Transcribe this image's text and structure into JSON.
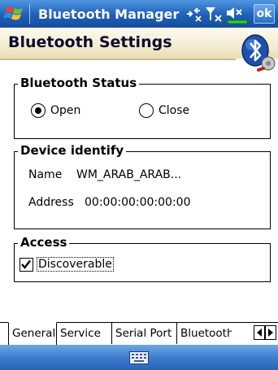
{
  "titlebar": {
    "app_title": "Bluetooth Manager",
    "ok_label": "ok"
  },
  "header": {
    "title": "Bluetooth Settings"
  },
  "status_group": {
    "title": "Bluetooth Status",
    "options": [
      {
        "label": "Open",
        "selected": true
      },
      {
        "label": "Close",
        "selected": false
      }
    ]
  },
  "device_group": {
    "title": "Device identify",
    "name_label": "Name",
    "name_value": "WM_ARAB_ARAB...",
    "address_label": "Address",
    "address_value": "00:00:00:00:00:00"
  },
  "access_group": {
    "title": "Access",
    "discoverable_label": "Discoverable",
    "discoverable_checked": true
  },
  "tabs": [
    {
      "label": "General",
      "active": true
    },
    {
      "label": "Service",
      "active": false
    },
    {
      "label": "Serial Port",
      "active": false
    },
    {
      "label": "Bluetooth H",
      "active": false
    }
  ],
  "colors": {
    "titlebar": "#1e5fb8",
    "header_band": "#f4ecd0",
    "bottombar": "#3f7dd0"
  },
  "icons": [
    "windows-start-icon",
    "connectivity-icon",
    "signal-off-icon",
    "volume-off-icon",
    "battery-icon",
    "bluetooth-logo-icon",
    "keyboard-icon"
  ]
}
